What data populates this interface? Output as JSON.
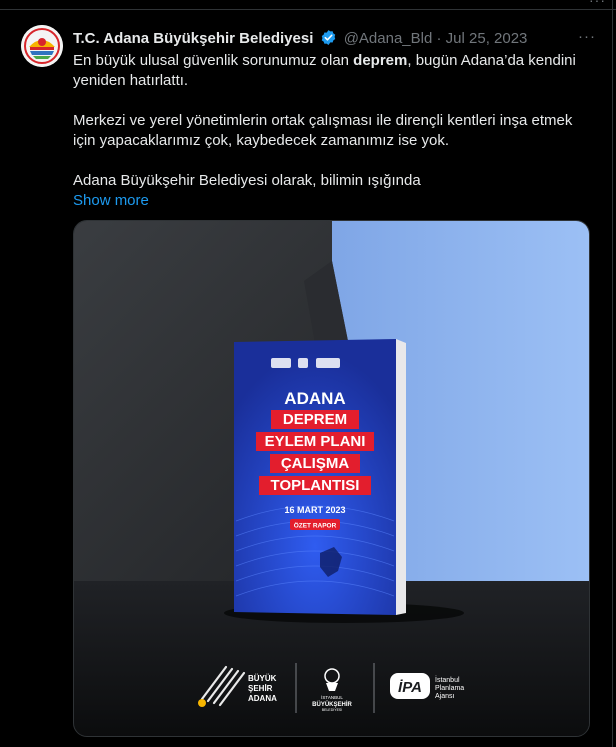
{
  "tweet": {
    "author_name": "T.C. Adana Büyükşehir Belediyesi",
    "handle": "@Adana_Bld",
    "separator": "·",
    "date": "Jul 25, 2023",
    "more_label": "···",
    "text": {
      "p1_a": "En büyük ulusal güvenlik sorunumuz olan ",
      "p1_bold": "deprem",
      "p1_b": ", bugün Adana’da kendini yeniden hatırlattı.",
      "p2": "Merkezi ve yerel yönetimlerin ortak çalışması ile dirençli kentleri inşa etmek için yapacaklarımız çok, kaybedecek zamanımız ise yok.",
      "p3": "Adana Büyükşehir Belediyesi olarak, bilimin ışığında"
    },
    "show_more": "Show more"
  },
  "media": {
    "book": {
      "title_1": "ADANA",
      "title_2": "DEPREM",
      "title_3": "EYLEM PLANI",
      "title_4": "ÇALIŞMA",
      "title_5": "TOPLANTISI",
      "date": "16 MART 2023",
      "badge": "ÖZET RAPOR"
    },
    "logos": {
      "buyuk_1": "BÜYÜK",
      "buyuk_2": "ŞEHİR",
      "buyuk_3": "ADANA",
      "ibb_1": "İSTANBUL",
      "ibb_2": "BÜYÜKŞEHİR",
      "ibb_3": "BELEDİYESİ",
      "ipa_mark": "İPA",
      "ipa_1": "İstanbul",
      "ipa_2": "Planlama",
      "ipa_3": "Ajansı"
    }
  },
  "colors": {
    "background": "#000000",
    "text": "#e7e9ea",
    "muted": "#71767b",
    "link": "#1d9bf0",
    "verified": "#1d9bf0",
    "book_blue": "#1f3fb8",
    "book_red": "#e31e2d"
  },
  "icons": {
    "verified": "verified-badge-icon",
    "more": "more-horizontal-icon"
  }
}
